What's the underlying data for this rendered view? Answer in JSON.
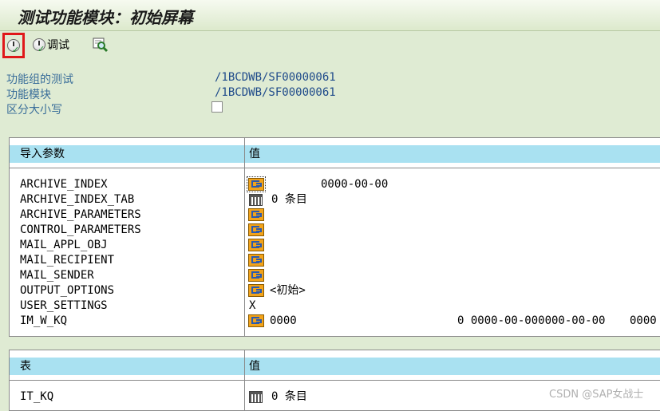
{
  "window": {
    "title": "测试功能模块：初始屏幕"
  },
  "toolbar": {
    "debug_label": "调试"
  },
  "fields": {
    "function_group_label": "功能组的测试",
    "function_group_value": "/1BCDWB/SF00000061",
    "function_module_label": "功能模块",
    "function_module_value": "/1BCDWB/SF00000061",
    "case_sensitive_label": "区分大小写",
    "case_sensitive_checked": false
  },
  "import_params": {
    "header_name": "导入参数",
    "header_value": "值",
    "rows": [
      {
        "name": "ARCHIVE_INDEX",
        "value": "0000-00-00"
      },
      {
        "name": "ARCHIVE_INDEX_TAB",
        "value": "0 条目"
      },
      {
        "name": "ARCHIVE_PARAMETERS",
        "value": ""
      },
      {
        "name": "CONTROL_PARAMETERS",
        "value": ""
      },
      {
        "name": "MAIL_APPL_OBJ",
        "value": ""
      },
      {
        "name": "MAIL_RECIPIENT",
        "value": ""
      },
      {
        "name": "MAIL_SENDER",
        "value": ""
      },
      {
        "name": "OUTPUT_OPTIONS",
        "value": "<初始>"
      },
      {
        "name": "USER_SETTINGS",
        "value": "X"
      },
      {
        "name": "IM_W_KQ",
        "value": "0000",
        "value2": "0 0000-00-000000-00-00",
        "value3": "0000"
      }
    ]
  },
  "tables": {
    "header_name": "表",
    "header_value": "值",
    "rows": [
      {
        "name": "IT_KQ",
        "value": "0 条目"
      }
    ]
  },
  "watermark": "CSDN @SAP女战士"
}
